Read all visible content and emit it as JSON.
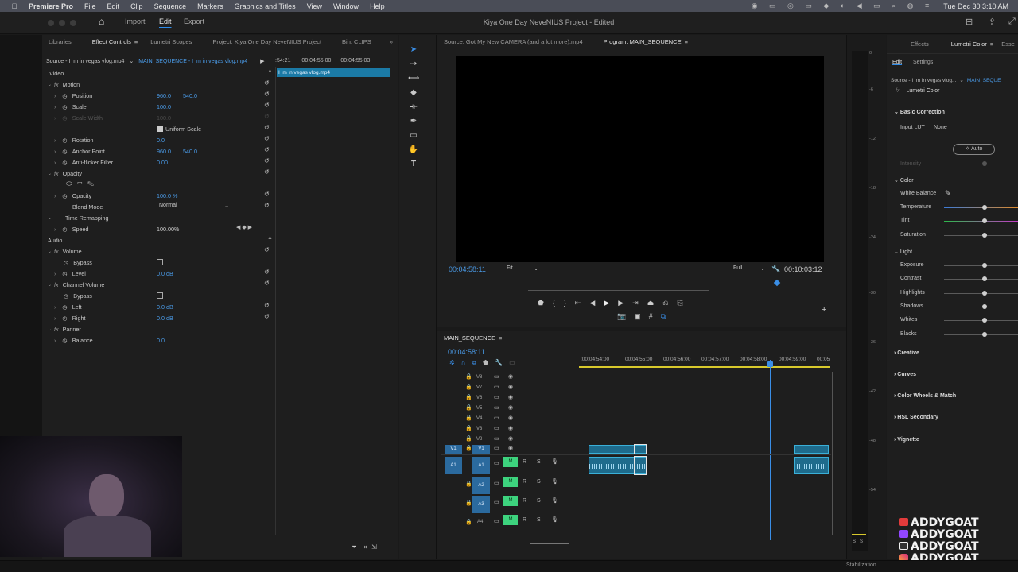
{
  "menubar": {
    "app": "Premiere Pro",
    "items": [
      "File",
      "Edit",
      "Clip",
      "Sequence",
      "Markers",
      "Graphics and Titles",
      "View",
      "Window",
      "Help"
    ],
    "clock": "Tue Dec 30  3:10 AM"
  },
  "window": {
    "title": "Kiya One Day NeveNIUS Project - Edited",
    "workspaces": {
      "import": "Import",
      "edit": "Edit",
      "export": "Export"
    }
  },
  "effect_controls": {
    "tabs": [
      "Libraries",
      "Effect Controls",
      "Lumetri Scopes",
      "Project: Kiya One Day NeveNIUS Project",
      "Bin: CLIPS"
    ],
    "source": "Source - I_m in vegas vlog.mp4",
    "sequence": "MAIN_SEQUENCE - I_m in vegas vlog.mp4",
    "time_a": ":54:21",
    "time_b": "00:04:55:00",
    "time_c": "00:04:55:03",
    "clip_label": "I_m in vegas vlog.mp4",
    "video": "Video",
    "motion": "Motion",
    "position": "Position",
    "position_x": "960.0",
    "position_y": "540.0",
    "scale": "Scale",
    "scale_val": "100.0",
    "scale_width": "Scale Width",
    "scale_width_val": "100.0",
    "uniform_scale": "Uniform Scale",
    "rotation": "Rotation",
    "rotation_val": "0.0",
    "anchor_point": "Anchor Point",
    "anchor_x": "960.0",
    "anchor_y": "540.0",
    "anti_flicker": "Anti-flicker Filter",
    "anti_flicker_val": "0.00",
    "opacity_section": "Opacity",
    "opacity": "Opacity",
    "opacity_val": "100.0 %",
    "blend_mode": "Blend Mode",
    "blend_mode_val": "Normal",
    "time_remapping": "Time Remapping",
    "speed": "Speed",
    "speed_val": "100.00%",
    "audio": "Audio",
    "volume": "Volume",
    "bypass": "Bypass",
    "level": "Level",
    "level_val": "0.0 dB",
    "channel_volume": "Channel Volume",
    "bypass2": "Bypass",
    "left": "Left",
    "left_val": "0.0 dB",
    "right": "Right",
    "right_val": "0.0 dB",
    "panner": "Panner",
    "balance": "Balance",
    "balance_val": "0.0"
  },
  "program": {
    "source_tab": "Source: Got My New CAMERA (and a lot more).mp4",
    "program_tab": "Program: MAIN_SEQUENCE",
    "timecode": "00:04:58:11",
    "fit": "Fit",
    "full": "Full",
    "duration": "00:10:03:12"
  },
  "timeline": {
    "name": "MAIN_SEQUENCE",
    "timecode": "00:04:58:11",
    "ruler": [
      ":00:04:54:00",
      "00:04:55:00",
      "00:04:56:00",
      "00:04:57:00",
      "00:04:58:00",
      "00:04:59:00",
      "00:05"
    ],
    "video_tracks": [
      "V8",
      "V7",
      "V6",
      "V5",
      "V4",
      "V3",
      "V2",
      "V1"
    ],
    "audio_tracks": [
      "A1",
      "A2",
      "A3",
      "A4"
    ],
    "v1_source": "V1",
    "a1_source": "A1",
    "mute": "M",
    "rec": "R",
    "solo": "S"
  },
  "lumetri": {
    "tabs": [
      "Effects",
      "Lumetri Color",
      "Esse"
    ],
    "subtabs": [
      "Edit",
      "Settings"
    ],
    "source": "Source - I_m in vegas vlog...",
    "sequence": "MAIN_SEQUE",
    "effect_name": "Lumetri Color",
    "basic_correction": "Basic Correction",
    "input_lut": "Input LUT",
    "input_lut_val": "None",
    "auto": "Auto",
    "intensity": "Intensity",
    "color": "Color",
    "white_balance": "White Balance",
    "temperature": "Temperature",
    "tint": "Tint",
    "saturation": "Saturation",
    "light": "Light",
    "exposure": "Exposure",
    "contrast": "Contrast",
    "highlights": "Highlights",
    "shadows": "Shadows",
    "whites": "Whites",
    "blacks": "Blacks",
    "creative": "Creative",
    "curves": "Curves",
    "color_wheels": "Color Wheels & Match",
    "hsl": "HSL Secondary",
    "vignette": "Vignette"
  },
  "meter": {
    "labels": [
      "0",
      "-6",
      "-12",
      "-18",
      "-24",
      "-30",
      "-36",
      "-42",
      "-48",
      "-54"
    ],
    "solo": "S",
    "solo2": "S"
  },
  "watermark": [
    "ADDYGOAT",
    "ADDYGOAT",
    "ADDYGOAT",
    "ADDYGOAT"
  ],
  "status": {
    "stabilization": "Stabilization"
  }
}
